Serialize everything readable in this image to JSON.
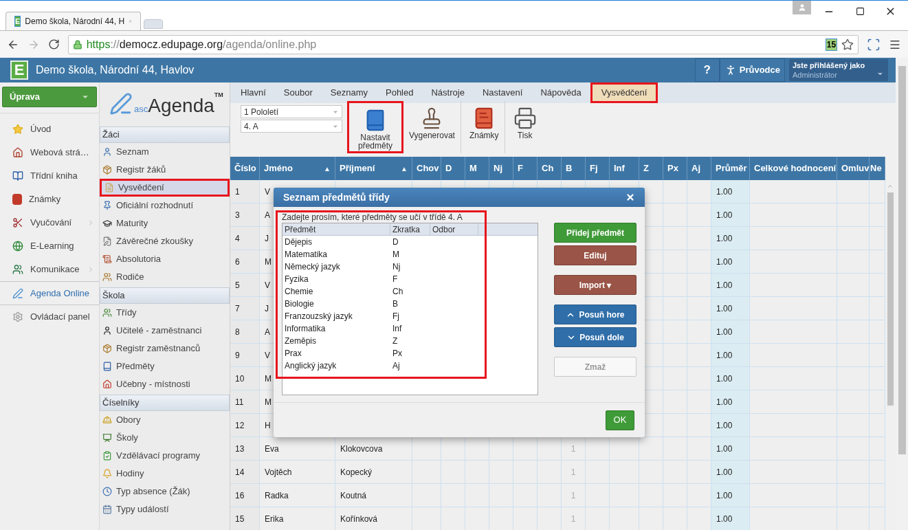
{
  "browser": {
    "tab": {
      "favicon": "E",
      "title": "Demo škola, Národní 44, H"
    },
    "address": {
      "scheme": "https",
      "separator": "://",
      "host": "democz.edupage.org",
      "path": "/agenda/online.php"
    },
    "extension_badge": "15"
  },
  "app_header": {
    "logo": "E",
    "title": "Demo škola, Národní 44, Havlov",
    "help": "?",
    "guide": "Průvodce",
    "user_label": "Jste přihlášený jako",
    "user_name": "Administrátor"
  },
  "nav": {
    "menu_button": "Úprava",
    "items": [
      {
        "label": "Úvod",
        "submenu": false,
        "selected": false,
        "divider_before": false
      },
      {
        "label": "Webová strá…",
        "submenu": false,
        "selected": false,
        "divider_before": false
      },
      {
        "label": "Třídní kniha",
        "submenu": false,
        "selected": false,
        "divider_before": false
      },
      {
        "label": "Známky",
        "submenu": false,
        "selected": false,
        "divider_before": false
      },
      {
        "label": "Vyučování",
        "submenu": true,
        "selected": false,
        "divider_before": false
      },
      {
        "label": "E-Learning",
        "submenu": false,
        "selected": false,
        "divider_before": false
      },
      {
        "label": "Komunikace",
        "submenu": true,
        "selected": false,
        "divider_before": false
      },
      {
        "label": "Agenda Online",
        "submenu": false,
        "selected": true,
        "divider_before": true
      },
      {
        "label": "Ovládací panel",
        "submenu": false,
        "selected": false,
        "divider_before": true
      }
    ]
  },
  "sidebar": {
    "logo": {
      "prefix": "asc",
      "name": "Agenda",
      "mark": "TM"
    },
    "sections": [
      {
        "title": "Žáci",
        "items": [
          {
            "label": "Seznam",
            "selected": false,
            "highlighted": false
          },
          {
            "label": "Registr žáků",
            "selected": false,
            "highlighted": false
          },
          {
            "label": "Vysvědčení",
            "selected": true,
            "highlighted": true
          },
          {
            "label": "Oficiální rozhodnutí",
            "selected": false,
            "highlighted": false
          },
          {
            "label": "Maturity",
            "selected": false,
            "highlighted": false
          },
          {
            "label": "Závěrečné zkoušky",
            "selected": false,
            "highlighted": false
          },
          {
            "label": "Absolutoria",
            "selected": false,
            "highlighted": false
          },
          {
            "label": "Rodiče",
            "selected": false,
            "highlighted": false
          }
        ]
      },
      {
        "title": "Škola",
        "items": [
          {
            "label": "Třídy",
            "selected": false,
            "highlighted": false
          },
          {
            "label": "Učitelé - zaměstnanci",
            "selected": false,
            "highlighted": false
          },
          {
            "label": "Registr zaměstnanců",
            "selected": false,
            "highlighted": false
          },
          {
            "label": "Předměty",
            "selected": false,
            "highlighted": false
          },
          {
            "label": "Učebny - místnosti",
            "selected": false,
            "highlighted": false
          }
        ]
      },
      {
        "title": "Číselníky",
        "items": [
          {
            "label": "Obory",
            "selected": false,
            "highlighted": false
          },
          {
            "label": "Školy",
            "selected": false,
            "highlighted": false
          },
          {
            "label": "Vzdělávací programy",
            "selected": false,
            "highlighted": false
          },
          {
            "label": "Hodiny",
            "selected": false,
            "highlighted": false
          },
          {
            "label": "Typ absence (Žák)",
            "selected": false,
            "highlighted": false
          },
          {
            "label": "Typy událostí",
            "selected": false,
            "highlighted": false
          }
        ]
      }
    ]
  },
  "menu_tabs": [
    {
      "label": "Hlavní",
      "selected": false,
      "highlighted": false
    },
    {
      "label": "Soubor",
      "selected": false,
      "highlighted": false
    },
    {
      "label": "Seznamy",
      "selected": false,
      "highlighted": false
    },
    {
      "label": "Pohled",
      "selected": false,
      "highlighted": false
    },
    {
      "label": "Nástroje",
      "selected": false,
      "highlighted": false
    },
    {
      "label": "Nastavení",
      "selected": false,
      "highlighted": false
    },
    {
      "label": "Nápověda",
      "selected": false,
      "highlighted": false
    },
    {
      "label": "Vysvědčení",
      "selected": true,
      "highlighted": true
    }
  ],
  "toolbar": {
    "selects": [
      {
        "value": "1 Pololetí"
      },
      {
        "value": "4. A"
      }
    ],
    "buttons": [
      {
        "label": "Nastavit předměty",
        "highlighted": true,
        "separator_after": false
      },
      {
        "label": "Vygenerovat",
        "highlighted": false,
        "separator_after": true
      },
      {
        "label": "Známky",
        "highlighted": false,
        "separator_after": true
      },
      {
        "label": "Tisk",
        "highlighted": false,
        "separator_after": false
      }
    ]
  },
  "table": {
    "columns": [
      {
        "label": "Číslo"
      },
      {
        "label": "Jméno",
        "sort_mark": "▲"
      },
      {
        "label": "Příjmení",
        "sort_mark": "▲"
      },
      {
        "label": "Chov"
      },
      {
        "label": "D"
      },
      {
        "label": "M"
      },
      {
        "label": "Nj"
      },
      {
        "label": "F"
      },
      {
        "label": "Ch"
      },
      {
        "label": "B"
      },
      {
        "label": "Fj"
      },
      {
        "label": "Inf"
      },
      {
        "label": "Z"
      },
      {
        "label": "Px"
      },
      {
        "label": "Aj"
      },
      {
        "label": "Průměr"
      },
      {
        "label": "Celkové hodnocení"
      },
      {
        "label": "Omluv"
      },
      {
        "label": "Ne"
      }
    ],
    "rows": [
      {
        "number": "1",
        "first_name": "V",
        "average": "1.00"
      },
      {
        "number": "3",
        "first_name": "A",
        "average": "1.00"
      },
      {
        "number": "4",
        "first_name": "J",
        "average": "1.00"
      },
      {
        "number": "6",
        "first_name": "M",
        "average": "1.00"
      },
      {
        "number": "5",
        "first_name": "V",
        "average": "1.00"
      },
      {
        "number": "7",
        "first_name": "J",
        "average": "1.00"
      },
      {
        "number": "8",
        "first_name": "A",
        "average": "1.00"
      },
      {
        "number": "9",
        "first_name": "V",
        "average": "1.00"
      },
      {
        "number": "10",
        "first_name": "M",
        "average": "1.00"
      },
      {
        "number": "11",
        "first_name": "M",
        "average": "1.00"
      },
      {
        "number": "12",
        "first_name": "H",
        "average": "1.00"
      },
      {
        "number": "13",
        "first_name": "Eva",
        "last_name": "Klokovcova",
        "b": "1",
        "average": "1.00"
      },
      {
        "number": "14",
        "first_name": "Vojtěch",
        "last_name": "Kopecký",
        "b": "1",
        "average": "1.00"
      },
      {
        "number": "16",
        "first_name": "Radka",
        "last_name": "Koutná",
        "b": "1",
        "average": "1.00"
      },
      {
        "number": "15",
        "first_name": "Erika",
        "last_name": "Kořínková",
        "b": "1",
        "average": "1.00"
      }
    ]
  },
  "dialog": {
    "title": "Seznam předmětů třídy",
    "instruction": "Zadejte prosím, které předměty se učí v třídě 4. A",
    "list": {
      "highlighted": true,
      "columns": [
        "Předmět",
        "Zkratka",
        "Odbor"
      ],
      "rows": [
        {
          "subject": "Dějepis",
          "abbr": "D"
        },
        {
          "subject": "Matematika",
          "abbr": "M"
        },
        {
          "subject": "Německý jazyk",
          "abbr": "Nj"
        },
        {
          "subject": "Fyzika",
          "abbr": "F"
        },
        {
          "subject": "Chemie",
          "abbr": "Ch"
        },
        {
          "subject": "Biologie",
          "abbr": "B"
        },
        {
          "subject": "Franzouzský jazyk",
          "abbr": "Fj"
        },
        {
          "subject": "Informatika",
          "abbr": "Inf"
        },
        {
          "subject": "Zeměpis",
          "abbr": "Z"
        },
        {
          "subject": "Prax",
          "abbr": "Px"
        },
        {
          "subject": "Anglický jazyk",
          "abbr": "Aj"
        }
      ]
    },
    "button_groups": [
      {
        "buttons": [
          {
            "label": "Přidej předmět",
            "kind": "primary"
          },
          {
            "label": "Edituj",
            "kind": "secondary"
          }
        ]
      },
      {
        "buttons": [
          {
            "label": "Import ▾",
            "kind": "secondary"
          }
        ]
      },
      {
        "buttons": [
          {
            "label": "Posuň hore",
            "kind": "move-up"
          },
          {
            "label": "Posuň dole",
            "kind": "move-down"
          }
        ]
      },
      {
        "buttons": [
          {
            "label": "Zmaž",
            "kind": "disabled"
          }
        ]
      }
    ],
    "ok": "OK"
  }
}
